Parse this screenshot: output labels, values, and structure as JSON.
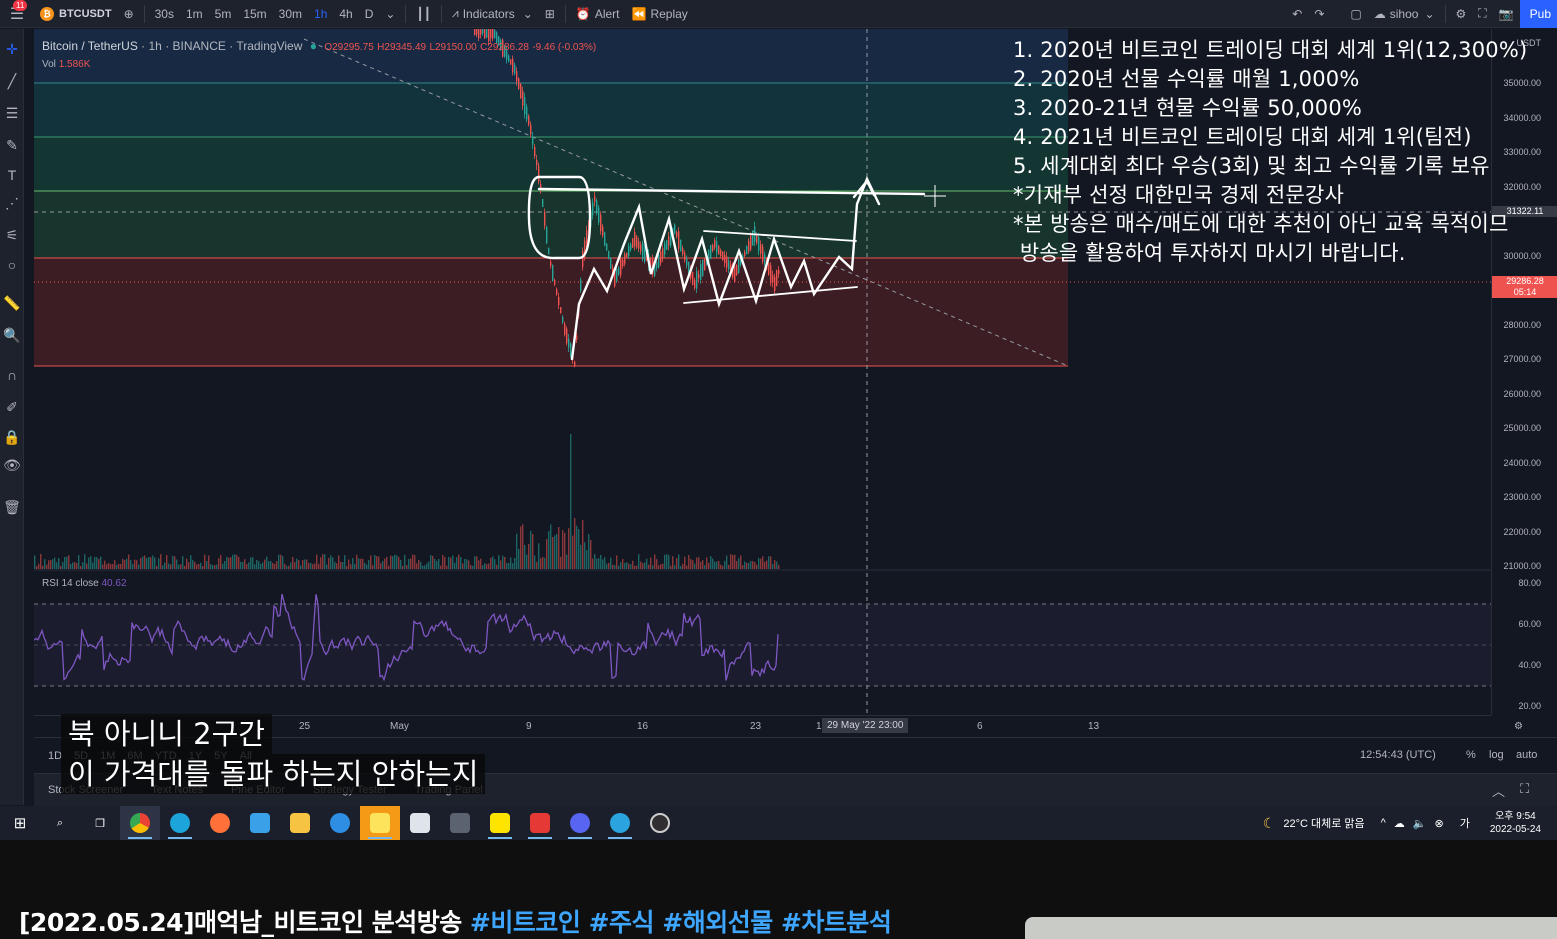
{
  "toolbar": {
    "notification_count": "11",
    "symbol": "BTCUSDT",
    "timeframes": [
      "30s",
      "1m",
      "5m",
      "15m",
      "30m",
      "1h",
      "4h",
      "D"
    ],
    "active_timeframe": "1h",
    "indicators_label": "Indicators",
    "alert_label": "Alert",
    "replay_label": "Replay",
    "user_label": "sihoo",
    "publish_label": "Pub"
  },
  "legend": {
    "pair": "Bitcoin / TetherUS",
    "interval": "1h",
    "exchange": "BINANCE",
    "source": "TradingView",
    "open": "O29295.75",
    "high": "H29345.49",
    "low": "L29150.00",
    "close": "C29286.28",
    "change": "-9.46 (-0.03%)",
    "vol_label": "Vol",
    "vol_value": "1.586K",
    "rsi_label": "RSI 14 close",
    "rsi_value": "40.62"
  },
  "price_scale": {
    "currency": "USDT",
    "ticks": [
      "35000.00",
      "34000.00",
      "33000.00",
      "32000.00",
      "30000.00",
      "28000.00",
      "27000.00",
      "26000.00",
      "25000.00",
      "24000.00",
      "23000.00",
      "22000.00",
      "21000.00"
    ],
    "crosshair_price": "31322.11",
    "last_price": "29286.28",
    "countdown": "05:14",
    "rsi_ticks": [
      "80.00",
      "60.00",
      "40.00",
      "20.00"
    ]
  },
  "time_axis": {
    "labels": [
      "25",
      "May",
      "9",
      "16",
      "23",
      "1",
      "6",
      "13"
    ],
    "crosshair_time": "29 May '22   23:00"
  },
  "bottom_bar": {
    "range_buttons": [
      "1D",
      "5D",
      "1M",
      "6M",
      "YTD",
      "1Y",
      "5Y",
      "All"
    ],
    "clock": "12:54:43 (UTC)",
    "percent": "%",
    "log": "log",
    "auto": "auto"
  },
  "panels_bar": {
    "tabs": [
      "Stock Screener",
      "Text Notes",
      "Pine Editor",
      "Strategy Tester",
      "Trading Panel"
    ]
  },
  "overlay_text": [
    "1. 2020년 비트코인 트레이딩 대회 세계 1위(12,300%)",
    "2. 2020년 선물 수익률 매월 1,000%",
    "3. 2020-21년 현물 수익률 50,000%",
    "4. 2021년 비트코인 트레이딩 대회 세계 1위(팀전)",
    "5. 세계대회 최다 우승(3회) 및 최고 수익률 기록 보유",
    "*기재부 선정 대한민국 경제 전문강사",
    "*본 방송은 매수/매도에 대한 추천이 아닌 교육 목적이므",
    " 방송을 활용하여 투자하지 마시기 바랍니다."
  ],
  "subtitles": {
    "line1": "북 아니니 2구간",
    "line2": "이 가격대를 돌파 하는지 안하는지"
  },
  "taskbar": {
    "weather": "22°C  대체로 맑음",
    "time": "오후 9:54",
    "date": "2022-05-24",
    "ime": "가"
  },
  "video_title": {
    "main": "[2022.05.24]매억남_비트코인 분석방송 ",
    "hashtags": [
      "#비트코인",
      "#주식",
      "#해외선물",
      "#차트분석"
    ]
  },
  "colors": {
    "bg": "#131722",
    "up": "#26a69a",
    "down": "#ef5350",
    "rsi": "#7e57c2",
    "accent": "#2962ff"
  }
}
